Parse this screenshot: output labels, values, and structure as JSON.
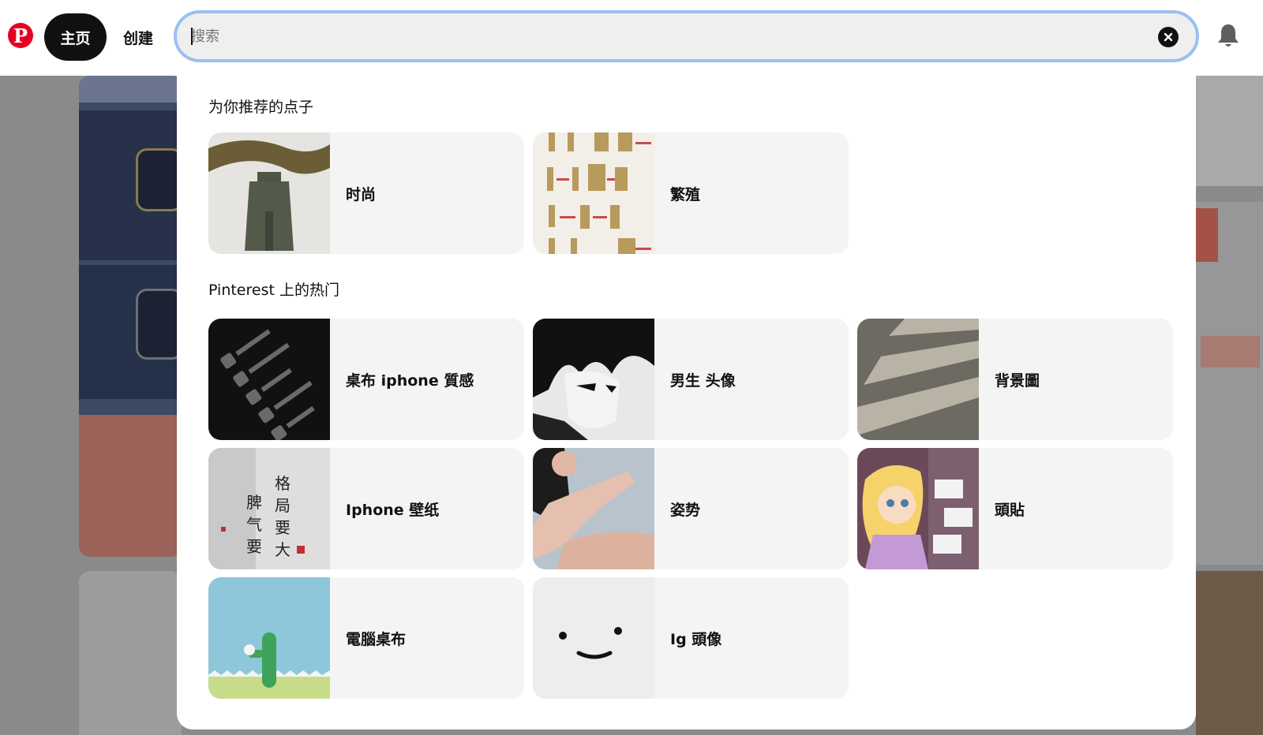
{
  "header": {
    "logo_letter": "P",
    "nav_home": "主页",
    "nav_create": "创建",
    "search_placeholder": "搜索",
    "icons": {
      "logo": "pinterest-logo",
      "clear": "close-circle-icon",
      "notifications": "bell-icon"
    }
  },
  "dropdown": {
    "recommended_title": "为你推荐的点子",
    "recommended": [
      {
        "label": "时尚",
        "thumb": "fashion-figure"
      },
      {
        "label": "繁殖",
        "thumb": "plant-propagation-diagram"
      }
    ],
    "trending_title": "Pinterest 上的热门",
    "trending": [
      {
        "label": "桌布 iphone 質感",
        "thumb": "dark-phone-icons"
      },
      {
        "label": "男生 头像",
        "thumb": "anime-boy"
      },
      {
        "label": "背景圖",
        "thumb": "crosswalk"
      },
      {
        "label": "Iphone 壁纸",
        "thumb": "chinese-calligraphy"
      },
      {
        "label": "姿势",
        "thumb": "hands-pose"
      },
      {
        "label": "頭貼",
        "thumb": "cartoon-princess"
      },
      {
        "label": "電腦桌布",
        "thumb": "green-cactus-character"
      },
      {
        "label": "Ig 頭像",
        "thumb": "smiley-face"
      }
    ]
  },
  "colors": {
    "brand": "#e60023",
    "focus_ring": "#9ac0f2",
    "card_bg": "#f4f4f4"
  }
}
